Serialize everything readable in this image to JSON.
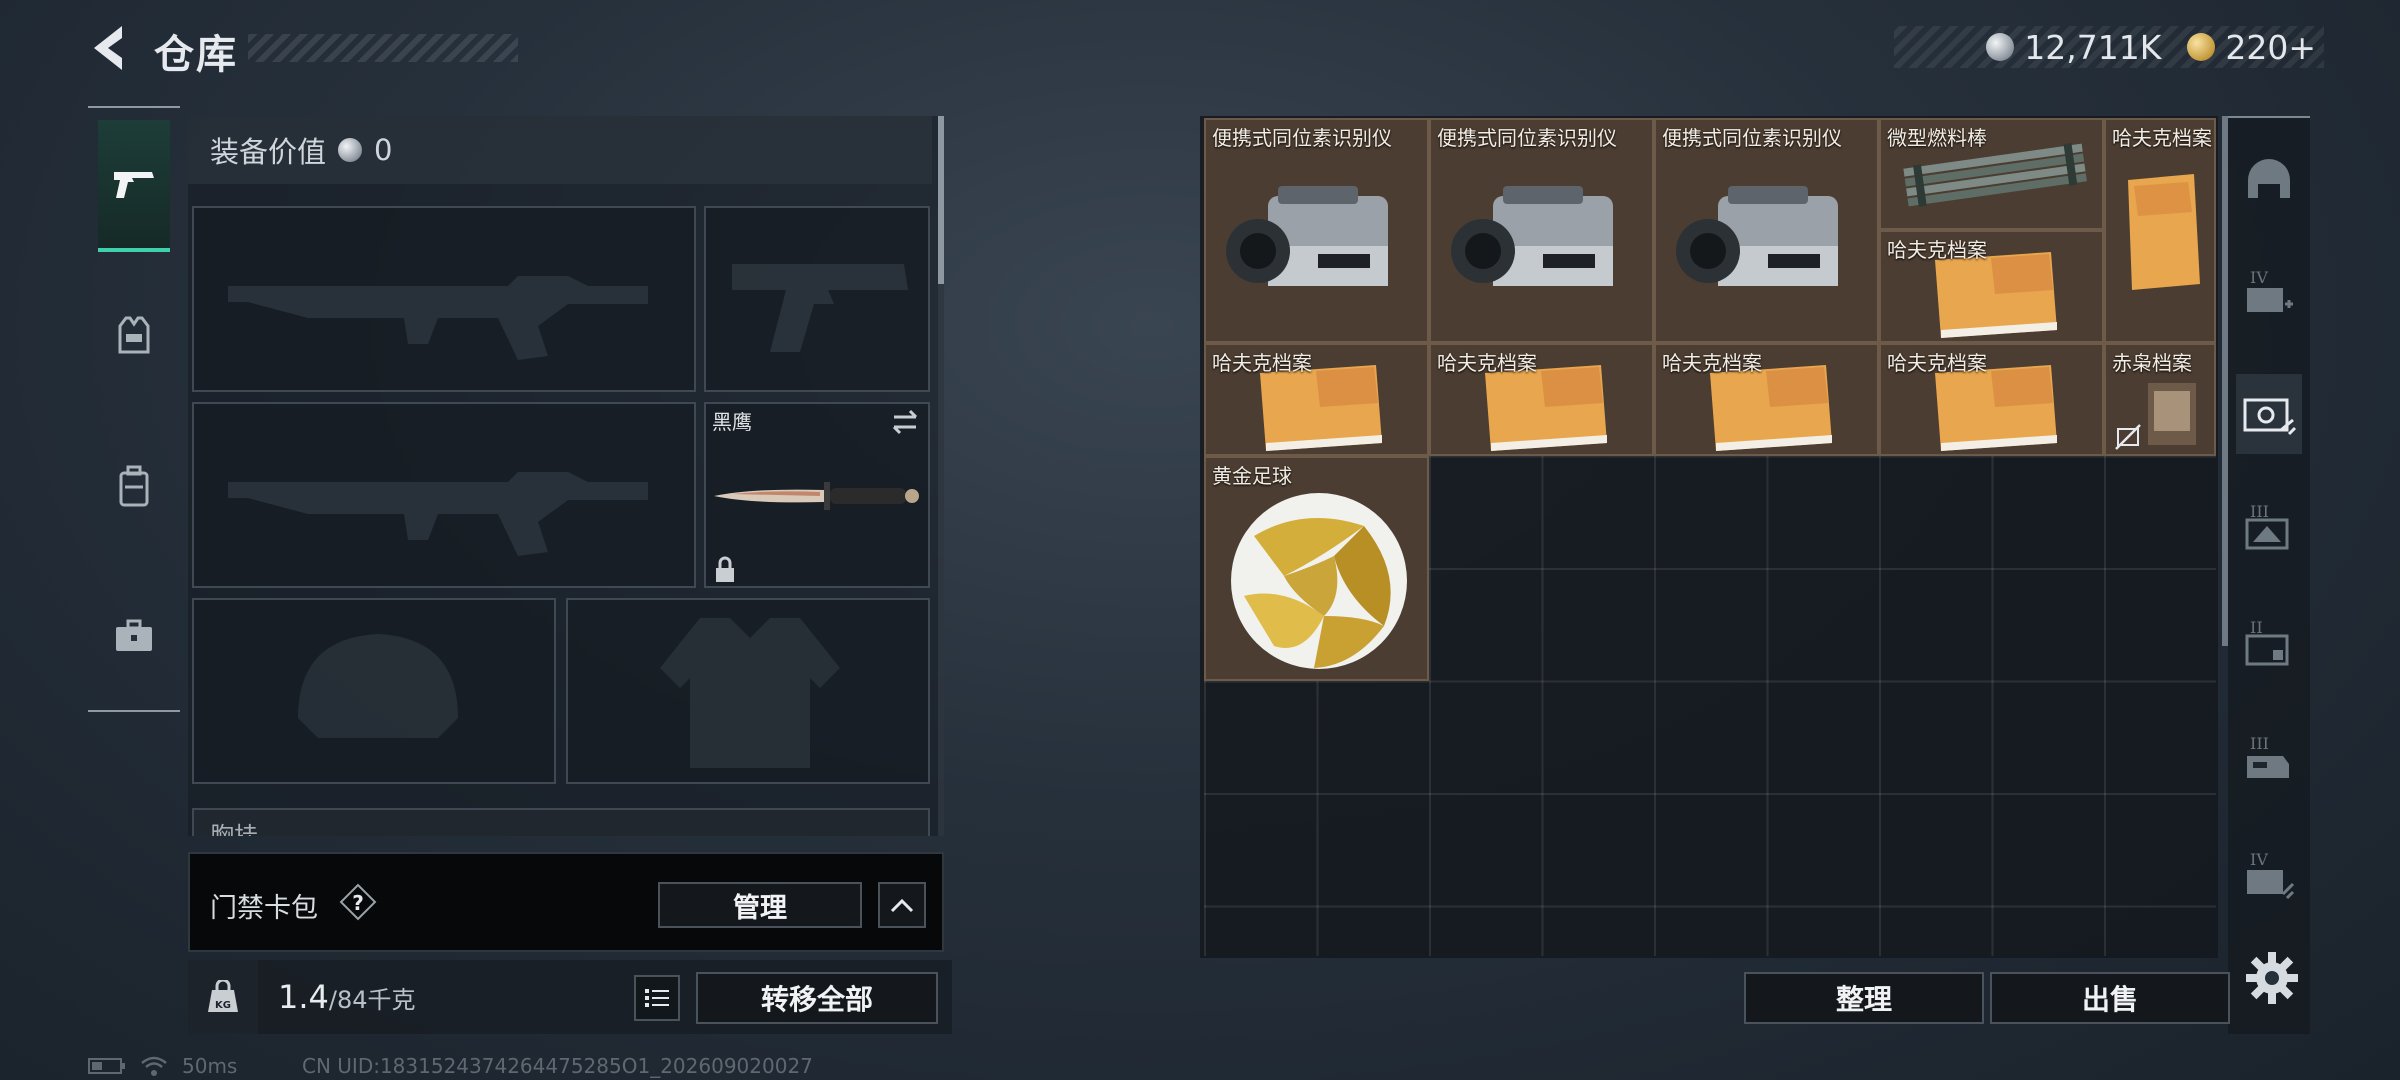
{
  "header": {
    "title": "仓库",
    "currency": [
      {
        "icon": "silver-coin-icon",
        "value": "12,711K"
      },
      {
        "icon": "gold-coin-icon",
        "value": "220+"
      }
    ]
  },
  "categories": [
    {
      "name": "weapons",
      "icon": "pistol-icon",
      "active": true
    },
    {
      "name": "armor",
      "icon": "vest-icon",
      "active": false
    },
    {
      "name": "backpack",
      "icon": "backpack-icon",
      "active": false
    },
    {
      "name": "toolbox",
      "icon": "toolbox-icon",
      "active": false
    }
  ],
  "equipment": {
    "value_label": "装备价值",
    "value": "0",
    "melee_name": "黑鹰",
    "chest_label": "胸挂"
  },
  "keycard": {
    "label": "门禁卡包",
    "help": "?",
    "manage": "管理"
  },
  "weight": {
    "current": "1.4",
    "capacity": "/84千克",
    "unit_icon": "KG"
  },
  "actions": {
    "transfer_all": "转移全部",
    "sort": "整理",
    "sell": "出售"
  },
  "stash_items": [
    {
      "name": "便携式同位素识别仪",
      "rarity_color": "#4b3d31"
    },
    {
      "name": "便携式同位素识别仪",
      "rarity_color": "#4b3d31"
    },
    {
      "name": "便携式同位素识别仪",
      "rarity_color": "#4b3d31"
    },
    {
      "name": "微型燃料棒",
      "rarity_color": "#4b3d31"
    },
    {
      "name": "哈夫克档案",
      "rarity_color": "#4b3d31"
    },
    {
      "name": "哈夫克档案",
      "rarity_color": "#4b3d31"
    },
    {
      "name": "哈夫克档案",
      "rarity_color": "#4b3d31"
    },
    {
      "name": "哈夫克档案",
      "rarity_color": "#4b3d31"
    },
    {
      "name": "哈夫克档案",
      "rarity_color": "#4b3d31"
    },
    {
      "name": "哈夫克档案",
      "rarity_color": "#4b3d31"
    },
    {
      "name": "赤枭档案",
      "rarity_color": "#4b3d31"
    },
    {
      "name": "黄金足球",
      "rarity_color": "#4b3d31"
    }
  ],
  "filter_tabs": [
    {
      "icon": "helmet-filter-icon",
      "tier": ""
    },
    {
      "icon": "weapon-case-add-icon",
      "tier": "IV"
    },
    {
      "icon": "weapon-case-swap-icon",
      "tier": ""
    },
    {
      "icon": "weapon-case-tier3-icon",
      "tier": "III"
    },
    {
      "icon": "weapon-case-tier2-icon",
      "tier": "II"
    },
    {
      "icon": "weapon-case-tier3b-icon",
      "tier": "III"
    },
    {
      "icon": "weapon-case-tier4-icon",
      "tier": "IV"
    }
  ],
  "status": {
    "ping": "50ms",
    "uid": "CN UID:1831524374264475285O1_202609020027"
  }
}
